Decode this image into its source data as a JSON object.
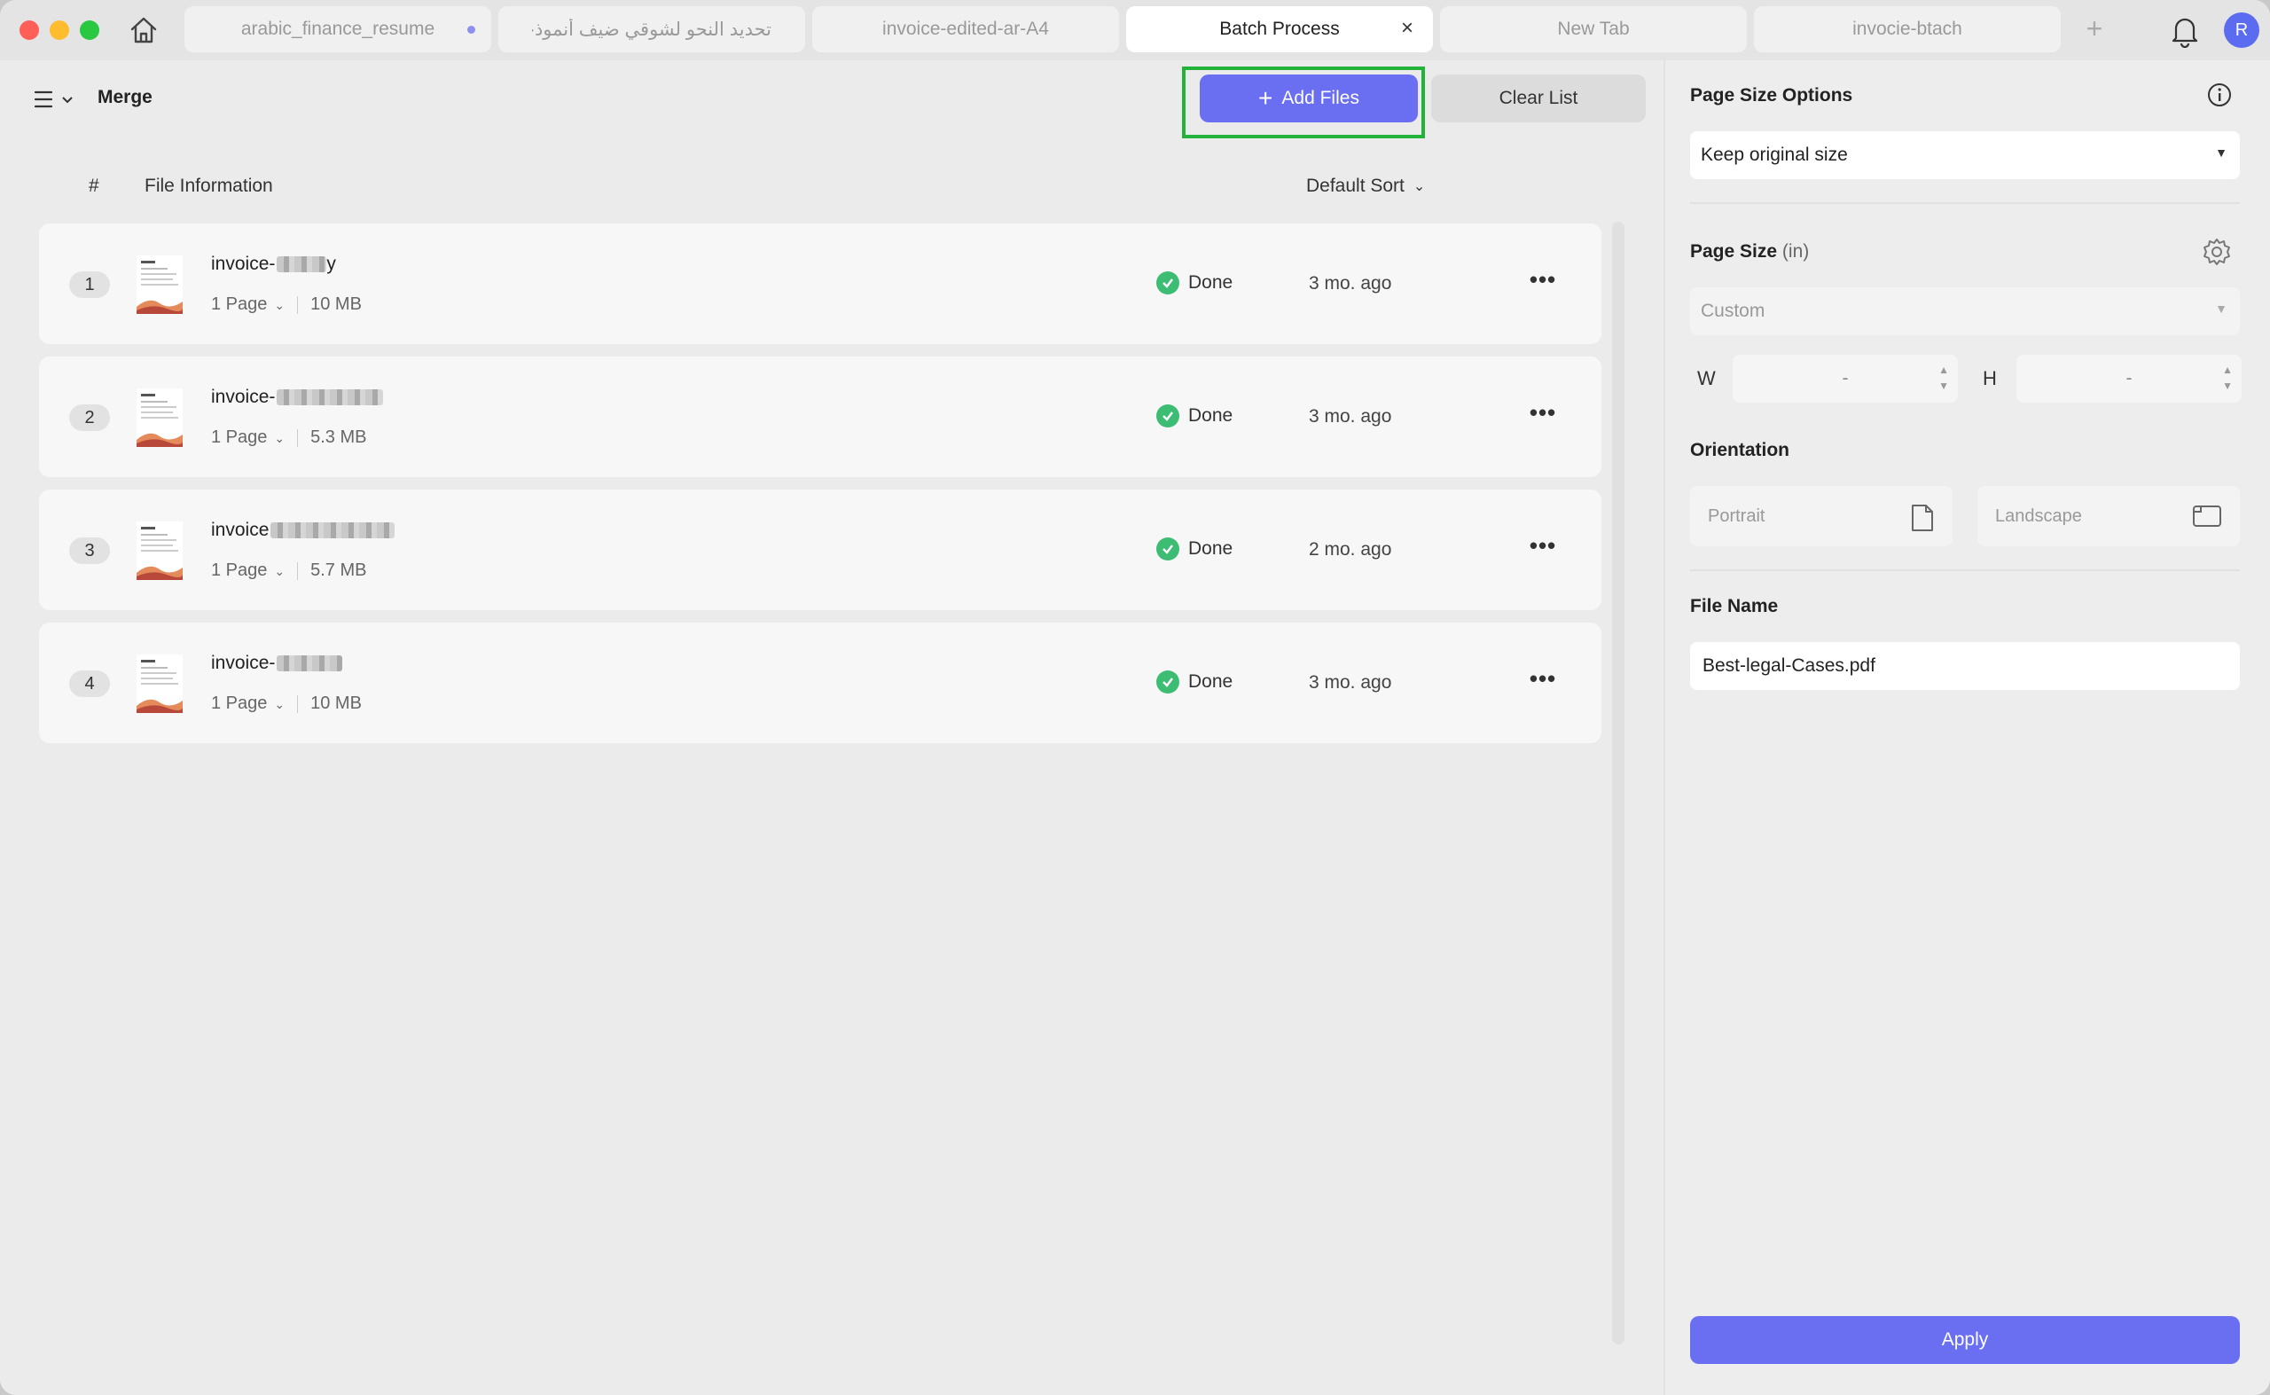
{
  "tabs": [
    {
      "label": "arabic_finance_resume",
      "state": "unsaved"
    },
    {
      "label": "تحديد النحو لشوقي ضيف أنموذجا",
      "state": "normal"
    },
    {
      "label": "invoice-edited-ar-A4",
      "state": "normal"
    },
    {
      "label": "Batch Process",
      "state": "active"
    },
    {
      "label": "New Tab",
      "state": "normal"
    },
    {
      "label": "invocie-btach",
      "state": "normal"
    }
  ],
  "user": {
    "avatar_initial": "R"
  },
  "main": {
    "title": "Merge",
    "add_files_label": "Add Files",
    "clear_list_label": "Clear List",
    "columns": {
      "number": "#",
      "file_info": "File Information"
    },
    "sort_label": "Default Sort",
    "files": [
      {
        "num": "1",
        "name": "invoice-",
        "name_suffix": "y",
        "pages": "1 Page",
        "size": "10 MB",
        "status": "Done",
        "time": "3 mo. ago"
      },
      {
        "num": "2",
        "name": "invoice-",
        "name_suffix": "",
        "pages": "1 Page",
        "size": "5.3 MB",
        "status": "Done",
        "time": "3 mo. ago"
      },
      {
        "num": "3",
        "name": "invoice",
        "name_suffix": "",
        "pages": "1 Page",
        "size": "5.7 MB",
        "status": "Done",
        "time": "2 mo. ago"
      },
      {
        "num": "4",
        "name": "invoice-",
        "name_suffix": "",
        "pages": "1 Page",
        "size": "10 MB",
        "status": "Done",
        "time": "3 mo. ago"
      }
    ]
  },
  "panel": {
    "page_size_options_label": "Page Size Options",
    "page_size_option_value": "Keep original size",
    "page_size_label": "Page Size",
    "page_size_unit": "(in)",
    "page_size_value": "Custom",
    "width_label": "W",
    "height_label": "H",
    "width_value": "-",
    "height_value": "-",
    "orientation_label": "Orientation",
    "portrait_label": "Portrait",
    "landscape_label": "Landscape",
    "file_name_label": "File Name",
    "file_name_value": "Best-legal-Cases.pdf",
    "apply_label": "Apply"
  },
  "colors": {
    "accent": "#6a6ff2",
    "success": "#3dbd74",
    "highlight": "#23b33a"
  }
}
